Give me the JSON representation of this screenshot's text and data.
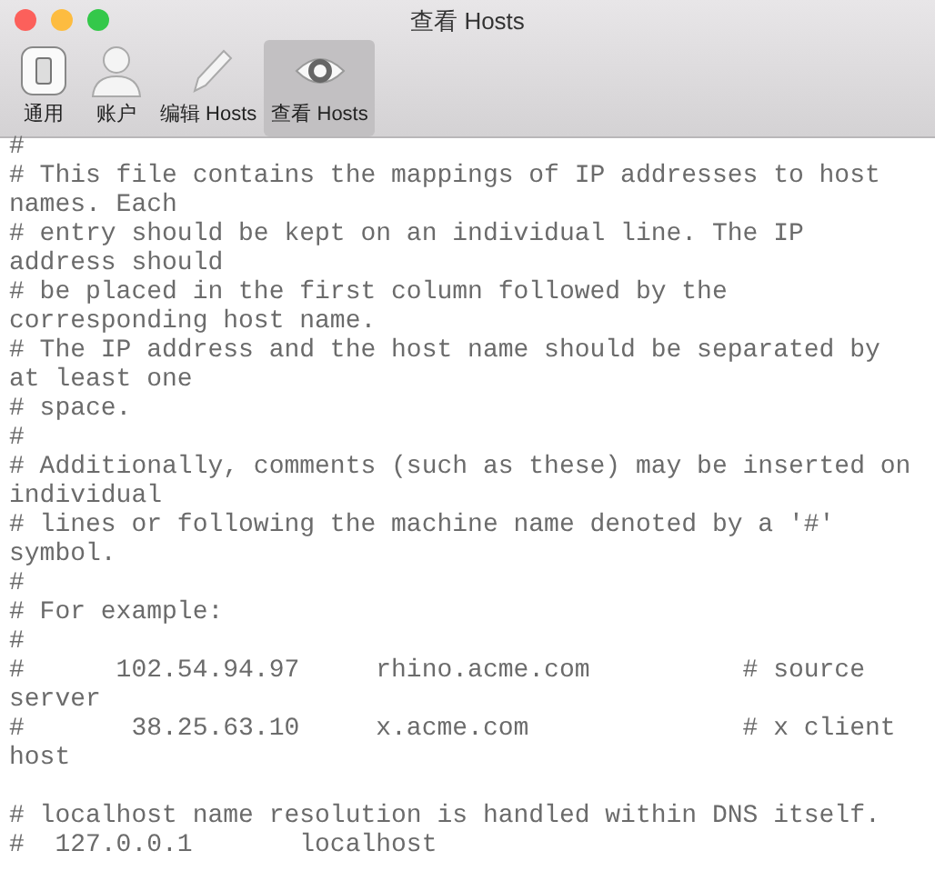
{
  "window": {
    "title": "查看 Hosts"
  },
  "toolbar": [
    {
      "label": "通用",
      "kind": "general",
      "selected": false
    },
    {
      "label": "账户",
      "kind": "account",
      "selected": false
    },
    {
      "label": "编辑 Hosts",
      "kind": "edit",
      "selected": false
    },
    {
      "label": "查看 Hosts",
      "kind": "view",
      "selected": true
    }
  ],
  "hosts_text": "#\n# This file contains the mappings of IP addresses to host names. Each\n# entry should be kept on an individual line. The IP address should\n# be placed in the first column followed by the corresponding host name.\n# The IP address and the host name should be separated by at least one\n# space.\n#\n# Additionally, comments (such as these) may be inserted on individual\n# lines or following the machine name denoted by a '#' symbol.\n#\n# For example:\n#\n#      102.54.94.97     rhino.acme.com          # source server\n#       38.25.63.10     x.acme.com              # x client host\n\n# localhost name resolution is handled within DNS itself.\n#  127.0.0.1       localhost"
}
